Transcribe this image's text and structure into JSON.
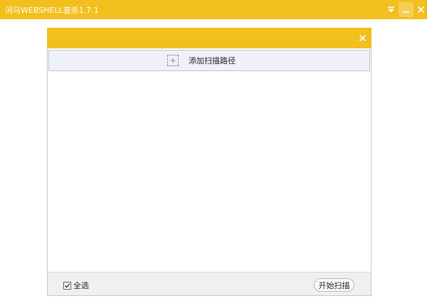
{
  "window": {
    "title": "河马WEBSHELL查杀1.7.1",
    "accent_color": "#f2bf1d",
    "controls": [
      "menu-icon",
      "minimize-icon",
      "close-icon"
    ]
  },
  "dialog": {
    "add_path_label": "添加扫描路径",
    "add_path_icon": "plus-icon",
    "close_icon": "close-icon",
    "select_all_label": "全选",
    "select_all_checked": true,
    "start_button_label": "开始扫描"
  }
}
